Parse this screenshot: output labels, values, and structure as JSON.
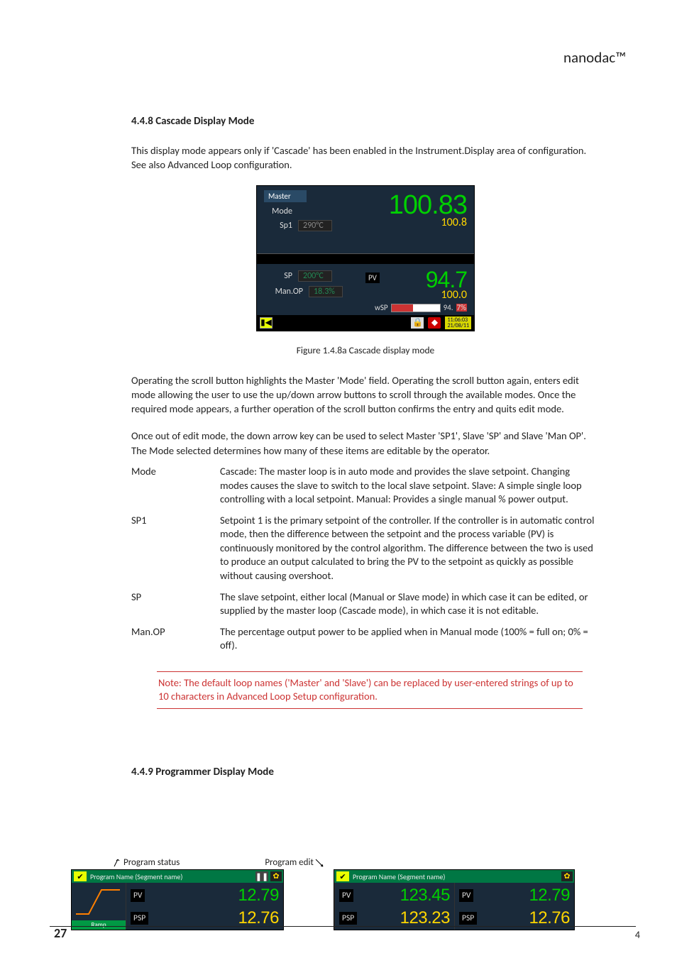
{
  "header": {
    "brand": "nanodac™"
  },
  "section1": {
    "num_title": "4.4.8 Cascade Display Mode",
    "intro": "This display mode appears only if 'Cascade' has been enabled in the Instrument.Display area of configuration.  See also Advanced Loop configuration.",
    "caption": "Figure 1.4.8a  Cascade display mode",
    "p1": "Operating the scroll button highlights the Master 'Mode' field.  Operating the scroll button again, enters edit mode allowing the user to use the up/down arrow buttons to scroll through the available modes.  Once the required mode appears, a further operation of the scroll button confirms the entry and quits edit mode.",
    "p2": "Once out of edit mode, the down arrow key can be used to select Master 'SP1', Slave 'SP' and Slave 'Man OP'.  The Mode selected determines how many of these items are editable by the operator.",
    "defs": [
      {
        "term": "Mode",
        "desc": "Cascade:  The master loop is in auto mode and provides the slave setpoint.  Changing modes causes the slave to switch to the local slave setpoint.\nSlave:  A simple single loop controlling with a local setpoint.\nManual:  Provides a single manual % power output."
      },
      {
        "term": "SP1",
        "desc": "Setpoint 1 is the primary setpoint of the controller.   If the controller is in automatic control mode, then the difference between the setpoint and the process variable (PV) is continuously monitored by the control algorithm.  The difference between the two is used to produce an output calculated to bring the PV to the setpoint as quickly as possible without causing overshoot."
      },
      {
        "term": "SP",
        "desc": "The slave setpoint, either local (Manual or Slave mode) in which case it can be edited, or supplied by the master loop (Cascade mode), in which case it is not editable."
      },
      {
        "term": "Man.OP",
        "desc": "The percentage output power to be applied when in Manual mode (100% = full on; 0% = off)."
      }
    ],
    "note": "Note:   The default loop names ('Master' and 'Slave') can be replaced by user-entered strings of up to 10 characters in Advanced Loop Setup configuration."
  },
  "cascade": {
    "master_label": "Master",
    "mode_label": "Mode",
    "sp1_label": "Sp1",
    "sp1_val": "290°C",
    "top_big": "100.83",
    "top_sub": "100.8",
    "sp_label": "SP",
    "sp_val": "200°C",
    "manop_label": "Man.OP",
    "manop_val": "18.3%",
    "pv_label": "PV",
    "bot_big": "94.7",
    "bot_sub": "100.0",
    "wsp_label": "wSP",
    "wsp_text": "94.",
    "wsp_pct_tail": "7%",
    "status_time1": "11:06:03",
    "status_time2": "21/08/11"
  },
  "section2": {
    "num_title": "4.4.9 Programmer Display Mode",
    "labels": {
      "status": "Program status",
      "edit": "Program edit"
    },
    "title_text": "Program Name (Segment name)",
    "ramp": "Ramp"
  },
  "prog_left": {
    "pv_label": "PV",
    "pv_val": "12.79",
    "psp_label": "PSP",
    "psp_val": "12.76"
  },
  "prog_right": {
    "colA": {
      "pv_label": "PV",
      "pv_val": "123.45",
      "psp_label": "PSP",
      "psp_val": "123.23"
    },
    "colB": {
      "pv_label": "PV",
      "pv_val": "12.79",
      "psp_label": "PSP",
      "psp_val": "12.76"
    }
  },
  "page": {
    "left": "27",
    "right_frag": "4"
  }
}
